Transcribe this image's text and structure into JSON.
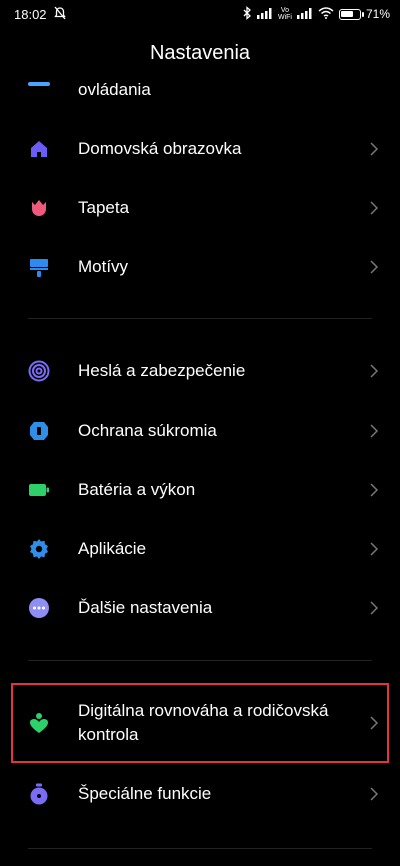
{
  "status_bar": {
    "time": "18:02",
    "volte_top": "Vo",
    "volte_bottom": "WiFi",
    "battery_percent": 71,
    "battery_text": "71%"
  },
  "header": {
    "title": "Nastavenia"
  },
  "list": {
    "partial_item": "ovládania",
    "items": [
      {
        "label": "Domovská obrazovka",
        "icon": "home-icon",
        "color": "#6b5cf6"
      },
      {
        "label": "Tapeta",
        "icon": "tulip-icon",
        "color": "#f05a7a"
      },
      {
        "label": "Motívy",
        "icon": "brush-icon",
        "color": "#2d8bf0"
      },
      {
        "label": "Heslá a zabezpečenie",
        "icon": "fingerprint-icon",
        "color": "#7a6cf5"
      },
      {
        "label": "Ochrana súkromia",
        "icon": "shield-icon",
        "color": "#2f8fe8"
      },
      {
        "label": "Batéria a výkon",
        "icon": "battery-icon",
        "color": "#2ed06a"
      },
      {
        "label": "Aplikácie",
        "icon": "gear-icon",
        "color": "#2f8fe8"
      },
      {
        "label": "Ďalšie nastavenia",
        "icon": "more-icon",
        "color": "#8e8ef5"
      },
      {
        "label": "Digitálna rovnováha a rodičovská kontrola",
        "icon": "person-heart-icon",
        "color": "#2ed06a"
      },
      {
        "label": "Špeciálne funkcie",
        "icon": "timer-icon",
        "color": "#7a6cf5"
      }
    ]
  }
}
